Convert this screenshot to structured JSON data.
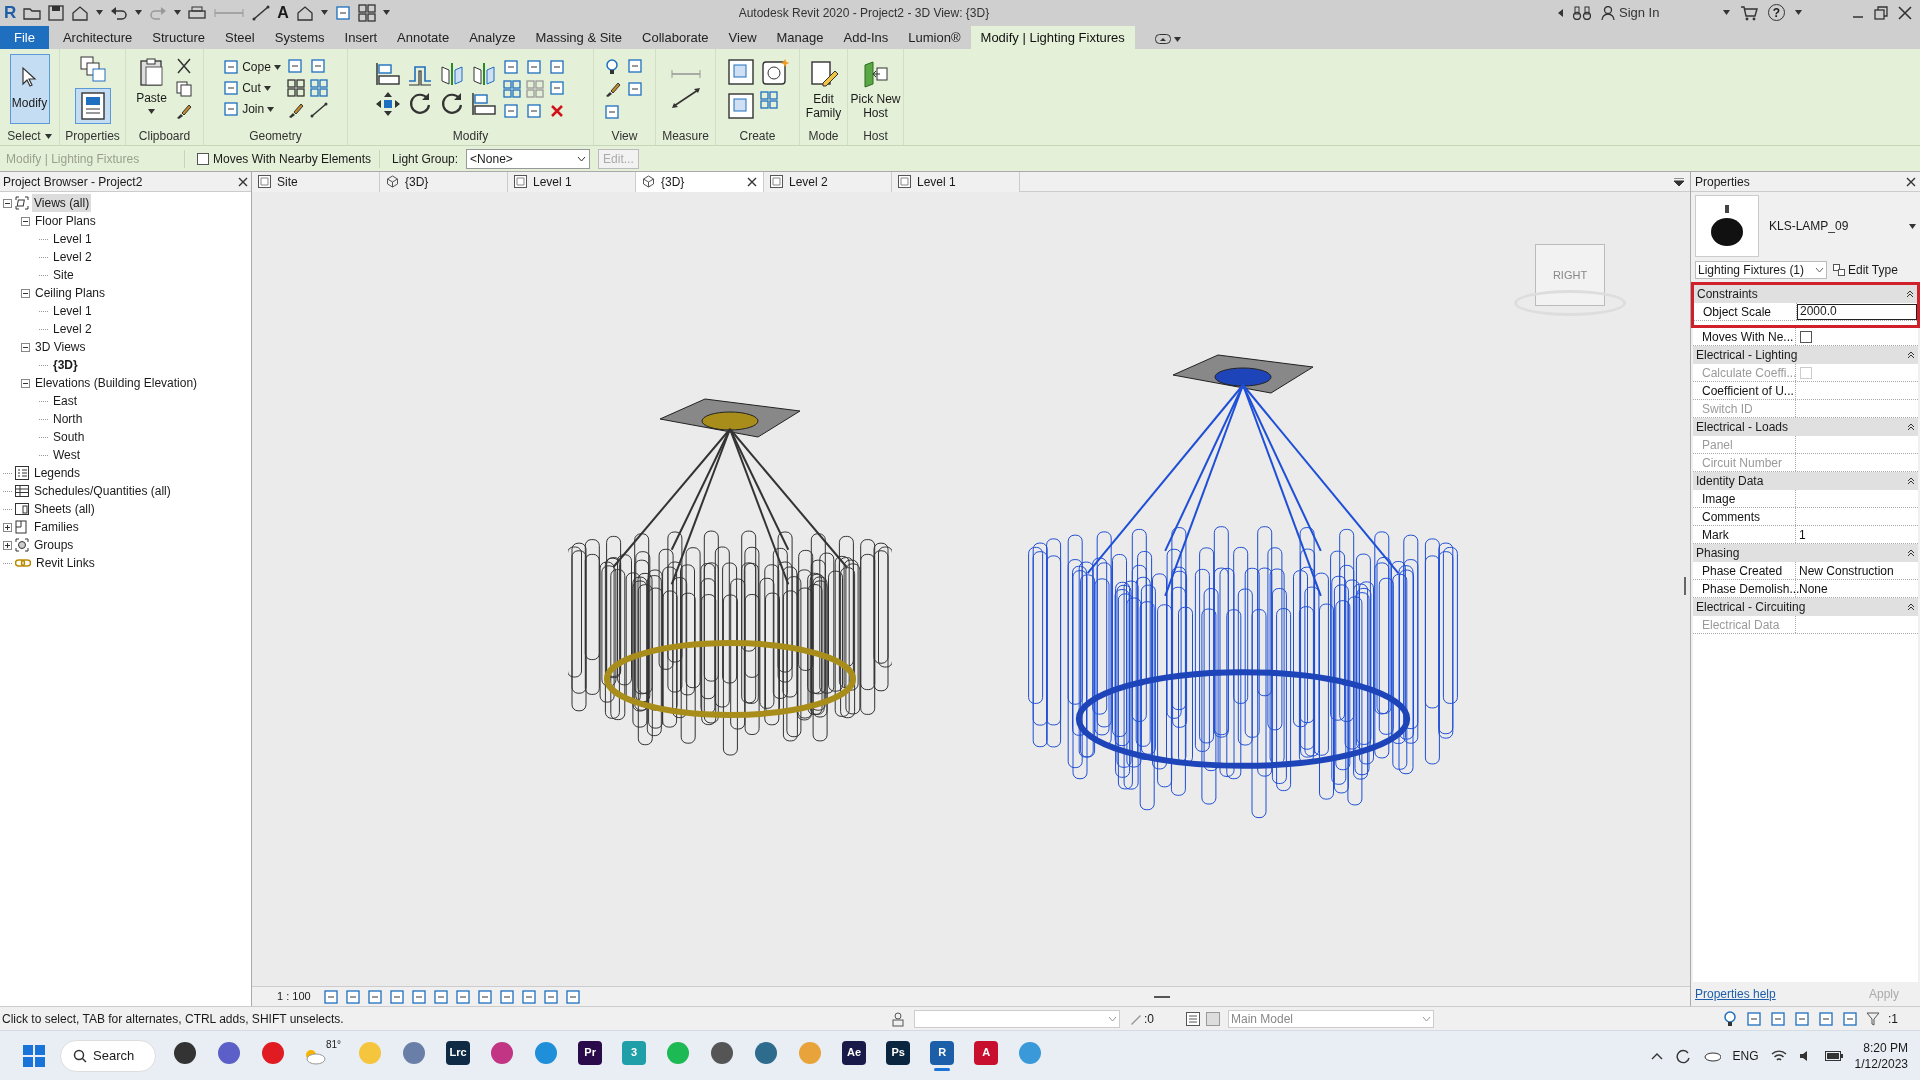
{
  "window": {
    "title": "Autodesk Revit 2020 - Project2 - 3D View: {3D}"
  },
  "quick_access": {
    "app_logo": "R",
    "text_tool": "A"
  },
  "title_bar": {
    "sign_in": "Sign In",
    "help": "?"
  },
  "ribbon_tabs": [
    {
      "label": "File",
      "kind": "file",
      "selected": false
    },
    {
      "label": "Architecture",
      "kind": "tab",
      "selected": false
    },
    {
      "label": "Structure",
      "kind": "tab",
      "selected": false
    },
    {
      "label": "Steel",
      "kind": "tab",
      "selected": false
    },
    {
      "label": "Systems",
      "kind": "tab",
      "selected": false
    },
    {
      "label": "Insert",
      "kind": "tab",
      "selected": false
    },
    {
      "label": "Annotate",
      "kind": "tab",
      "selected": false
    },
    {
      "label": "Analyze",
      "kind": "tab",
      "selected": false
    },
    {
      "label": "Massing & Site",
      "kind": "tab",
      "selected": false
    },
    {
      "label": "Collaborate",
      "kind": "tab",
      "selected": false
    },
    {
      "label": "View",
      "kind": "tab",
      "selected": false
    },
    {
      "label": "Manage",
      "kind": "tab",
      "selected": false
    },
    {
      "label": "Add-Ins",
      "kind": "tab",
      "selected": false
    },
    {
      "label": "Lumion®",
      "kind": "tab",
      "selected": false
    },
    {
      "label": "Modify | Lighting Fixtures",
      "kind": "tab",
      "selected": true
    }
  ],
  "ribbon_panels": [
    {
      "kind": "select",
      "title": "Select",
      "labels": [
        "Modify"
      ]
    },
    {
      "kind": "properties",
      "title": "Properties"
    },
    {
      "kind": "clipboard",
      "title": "Clipboard",
      "labels": [
        "Paste"
      ]
    },
    {
      "kind": "geometry",
      "title": "Geometry",
      "labels": [
        "Cope",
        "Cut",
        "Join"
      ]
    },
    {
      "kind": "modify",
      "title": "Modify"
    },
    {
      "kind": "view",
      "title": "View"
    },
    {
      "kind": "measure",
      "title": "Measure"
    },
    {
      "kind": "create",
      "title": "Create"
    },
    {
      "kind": "mode",
      "title": "Mode",
      "labels": [
        "Edit Family"
      ]
    },
    {
      "kind": "host",
      "title": "Host",
      "labels": [
        "Pick New Host"
      ]
    }
  ],
  "options_bar": {
    "context": "Modify | Lighting Fixtures",
    "moves_with_nearby": {
      "label": "Moves With Nearby Elements",
      "checked": false
    },
    "light_group": {
      "label": "Light Group:",
      "value": "<None>"
    },
    "edit_button": {
      "label": "Edit...",
      "disabled": true
    }
  },
  "project_browser": {
    "title": "Project Browser - Project2",
    "tree": [
      {
        "label": "Views (all)",
        "kind": "views",
        "expanded": true,
        "selected": true,
        "active": false,
        "children": [
          {
            "label": "Floor Plans",
            "expanded": true,
            "selected": false,
            "active": false,
            "children": [
              {
                "label": "Level 1",
                "selected": false,
                "active": false
              },
              {
                "label": "Level 2",
                "selected": false,
                "active": false
              },
              {
                "label": "Site",
                "selected": false,
                "active": false
              }
            ]
          },
          {
            "label": "Ceiling Plans",
            "expanded": true,
            "selected": false,
            "active": false,
            "children": [
              {
                "label": "Level 1",
                "selected": false,
                "active": false
              },
              {
                "label": "Level 2",
                "selected": false,
                "active": false
              }
            ]
          },
          {
            "label": "3D Views",
            "expanded": true,
            "selected": false,
            "active": false,
            "children": [
              {
                "label": "{3D}",
                "selected": false,
                "active": true
              }
            ]
          },
          {
            "label": "Elevations (Building Elevation)",
            "expanded": true,
            "selected": false,
            "active": false,
            "children": [
              {
                "label": "East",
                "selected": false,
                "active": false
              },
              {
                "label": "North",
                "selected": false,
                "active": false
              },
              {
                "label": "South",
                "selected": false,
                "active": false
              },
              {
                "label": "West",
                "selected": false,
                "active": false
              }
            ]
          }
        ]
      },
      {
        "label": "Legends",
        "kind": "legends",
        "selected": false,
        "active": false
      },
      {
        "label": "Schedules/Quantities (all)",
        "kind": "schedules",
        "selected": false,
        "active": false
      },
      {
        "label": "Sheets (all)",
        "kind": "sheets",
        "selected": false,
        "active": false
      },
      {
        "label": "Families",
        "kind": "families",
        "expanded": false,
        "selected": false,
        "active": false
      },
      {
        "label": "Groups",
        "kind": "groups",
        "expanded": false,
        "selected": false,
        "active": false
      },
      {
        "label": "Revit Links",
        "kind": "links",
        "selected": false,
        "active": false
      }
    ]
  },
  "view_tabs": [
    {
      "label": "Site",
      "kind": "plan",
      "selected": false
    },
    {
      "label": "{3D}",
      "kind": "perspective",
      "selected": false
    },
    {
      "label": "Level 1",
      "kind": "plan",
      "selected": false
    },
    {
      "label": "{3D}",
      "kind": "perspective",
      "selected": true
    },
    {
      "label": "Level 2",
      "kind": "plan",
      "selected": false
    },
    {
      "label": "Level 1",
      "kind": "plan",
      "selected": false
    }
  ],
  "viewport": {
    "viewcube_face": "RIGHT"
  },
  "view_control_bar": {
    "scale": "1 : 100"
  },
  "properties": {
    "title": "Properties",
    "type_name": "KLS-LAMP_09",
    "selector": "Lighting Fixtures (1)",
    "edit_type": "Edit Type",
    "groups": [
      {
        "title": "Constraints",
        "highlighted": true,
        "rows": [
          {
            "label": "Object Scale",
            "kind": "edit",
            "value": "2000.0",
            "disabled": false
          }
        ]
      },
      {
        "highlighted": false,
        "rows": [
          {
            "label": "Moves With Ne...",
            "kind": "checkbox",
            "checked": false,
            "disabled": false
          }
        ]
      },
      {
        "title": "Electrical - Lighting",
        "highlighted": false,
        "rows": [
          {
            "label": "Calculate Coeffi...",
            "kind": "checkbox",
            "checked": false,
            "disabled": true
          },
          {
            "label": "Coefficient of U...",
            "kind": "text",
            "value": "",
            "disabled": false
          },
          {
            "label": "Switch ID",
            "kind": "text",
            "value": "",
            "disabled": true
          }
        ]
      },
      {
        "title": "Electrical - Loads",
        "highlighted": false,
        "rows": [
          {
            "label": "Panel",
            "kind": "text",
            "value": "",
            "disabled": true
          },
          {
            "label": "Circuit Number",
            "kind": "text",
            "value": "",
            "disabled": true
          }
        ]
      },
      {
        "title": "Identity Data",
        "highlighted": false,
        "rows": [
          {
            "label": "Image",
            "kind": "text",
            "value": "",
            "disabled": false
          },
          {
            "label": "Comments",
            "kind": "text",
            "value": "",
            "disabled": false
          },
          {
            "label": "Mark",
            "kind": "text",
            "value": "1",
            "disabled": false
          }
        ]
      },
      {
        "title": "Phasing",
        "highlighted": false,
        "rows": [
          {
            "label": "Phase Created",
            "kind": "text",
            "value": "New Construction",
            "disabled": false
          },
          {
            "label": "Phase Demolish...",
            "kind": "text",
            "value": "None",
            "disabled": false
          }
        ]
      },
      {
        "title": "Electrical - Circuiting",
        "highlighted": false,
        "rows": [
          {
            "label": "Electrical Data",
            "kind": "text",
            "value": "",
            "disabled": true
          }
        ]
      }
    ],
    "help_link": "Properties help",
    "apply": {
      "label": "Apply",
      "disabled": true
    }
  },
  "status_bar": {
    "message": "Click to select, TAB for alternates, CTRL adds, SHIFT unselects.",
    "count_left": ":0",
    "model": "Main Model",
    "count_right": ":1"
  },
  "taskbar": {
    "search": "Search",
    "weather": "81°",
    "apps": [
      {
        "kind": "icon",
        "color": "#333333",
        "selected": false
      },
      {
        "kind": "icon",
        "color": "#5b5fc7",
        "selected": false
      },
      {
        "kind": "icon",
        "color": "#e01b22",
        "selected": false
      },
      {
        "kind": "icon",
        "color": "#f4c53d",
        "selected": false
      },
      {
        "kind": "icon",
        "color": "#6a7fa8",
        "selected": false
      },
      {
        "kind": "tile",
        "label": "Lrc",
        "color": "#0f2a44",
        "selected": false
      },
      {
        "kind": "icon",
        "color": "#c13584",
        "selected": false
      },
      {
        "kind": "icon",
        "color": "#1e8fd8",
        "selected": false
      },
      {
        "kind": "tile",
        "label": "Pr",
        "color": "#2a0a4a",
        "selected": false
      },
      {
        "kind": "tile",
        "label": "3",
        "color": "#1f9fa8",
        "selected": false
      },
      {
        "kind": "icon",
        "color": "#1db954",
        "selected": false
      },
      {
        "kind": "icon",
        "color": "#555555",
        "selected": false
      },
      {
        "kind": "icon",
        "color": "#2d6c8c",
        "selected": false
      },
      {
        "kind": "icon",
        "color": "#e8a43a",
        "selected": false
      },
      {
        "kind": "tile",
        "label": "Ae",
        "color": "#1a1a4a",
        "selected": false
      },
      {
        "kind": "tile",
        "label": "Ps",
        "color": "#0a2540",
        "selected": false
      },
      {
        "kind": "tile",
        "label": "R",
        "color": "#1c5ea8",
        "selected": true
      },
      {
        "kind": "tile",
        "label": "A",
        "color": "#c8102e",
        "selected": false
      },
      {
        "kind": "icon",
        "color": "#3a9ad9",
        "selected": false
      }
    ],
    "language": "ENG",
    "time": "8:20 PM",
    "date": "1/12/2023"
  }
}
